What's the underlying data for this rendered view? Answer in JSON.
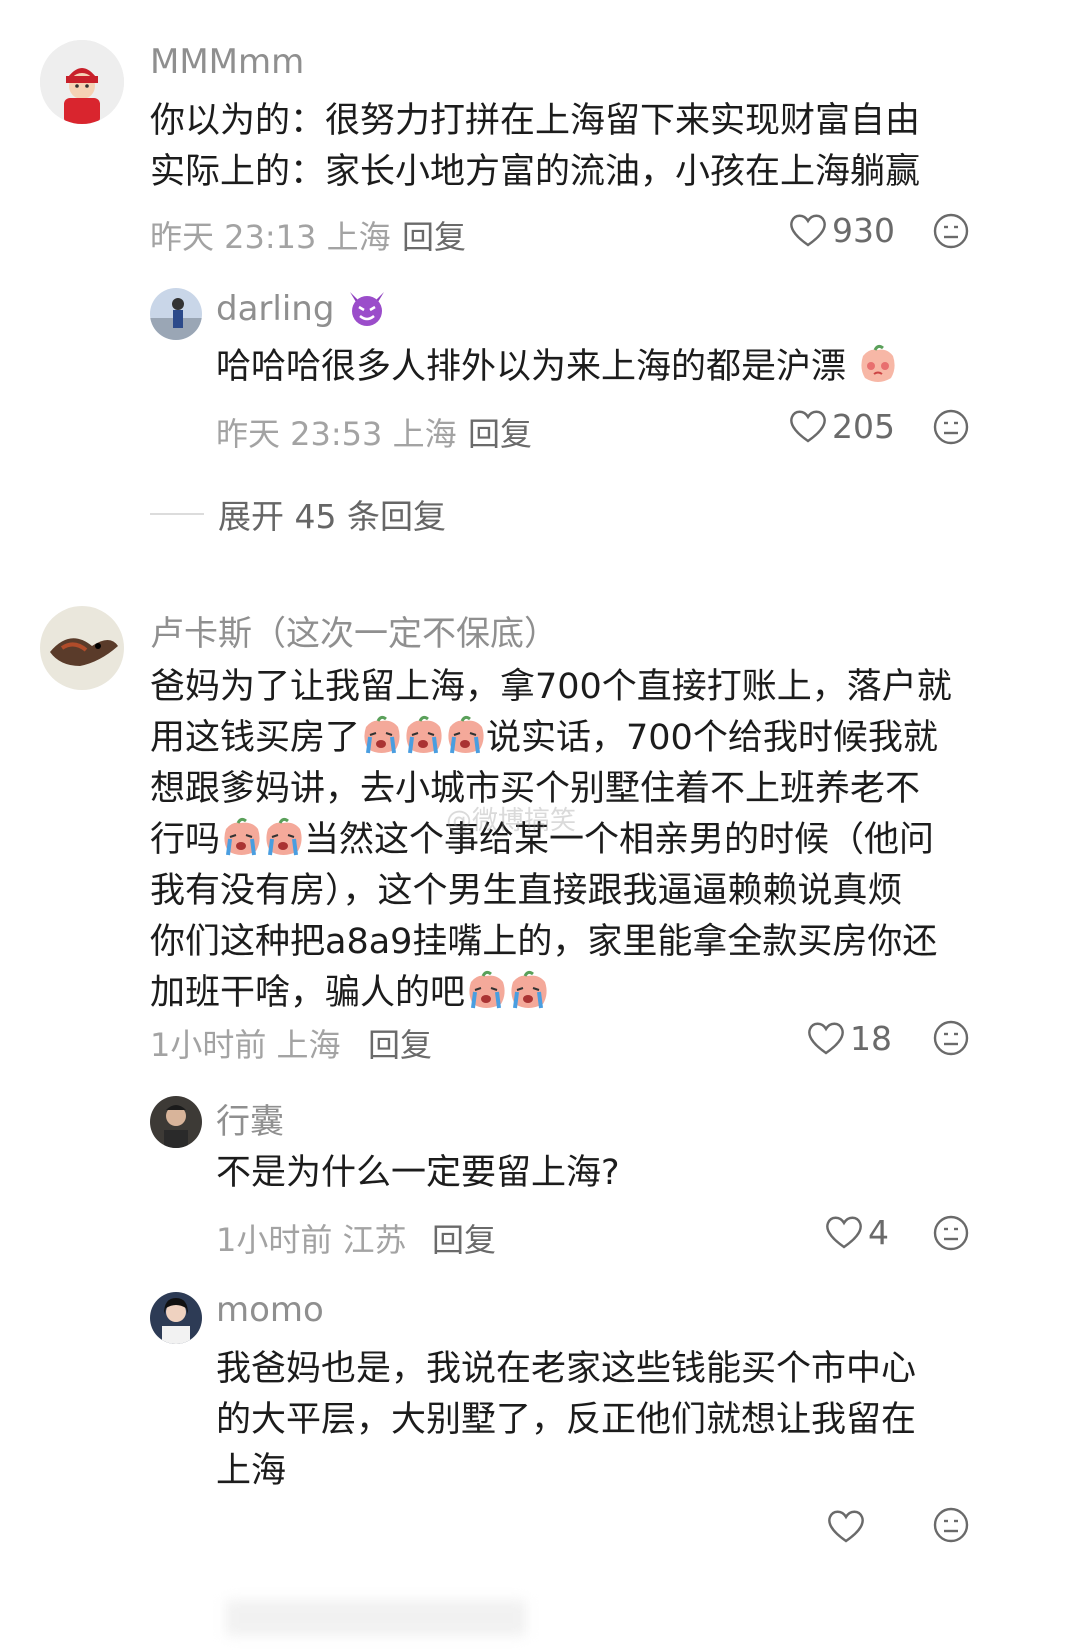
{
  "comments": [
    {
      "user": "MMMmm",
      "text_lines": [
        "你以为的：很努力打拼在上海留下来实现财富自由",
        "实际上的：家长小地方富的流油，小孩在上海躺赢"
      ],
      "time": "昨天 23:13 上海",
      "reply_label": "回复",
      "likes": "930"
    },
    {
      "user": "darling",
      "text": "哈哈哈很多人排外以为来上海的都是沪漂",
      "time": "昨天 23:53 上海",
      "reply_label": "回复",
      "likes": "205",
      "expand_label": "展开 45 条回复"
    },
    {
      "user": "卢卡斯（这次一定不保底）",
      "lines": [
        "爸妈为了让我留上海，拿700个直接打账上，落户就",
        [
          "用这钱买房了",
          "说实话，700个给我时候我就"
        ],
        "想跟爹妈讲，去小城市买个别墅住着不上班养老不",
        [
          "行吗",
          "当然这个事给某一个相亲男的时候（他问"
        ],
        "我有没有房），这个男生直接跟我逼逼赖赖说真烦",
        "你们这种把a8a9挂嘴上的，家里能拿全款买房你还",
        "加班干啥，骗人的吧"
      ],
      "time": "1小时前 上海",
      "reply_label": "回复",
      "likes": "18"
    },
    {
      "user": "行囊",
      "text": "不是为什么一定要留上海?",
      "time": "1小时前 江苏",
      "reply_label": "回复",
      "likes": "4"
    },
    {
      "user": "momo",
      "text_lines": [
        "我爸妈也是，我说在老家这些钱能买个市中心",
        "的大平层，大别墅了，反正他们就想让我留在",
        "上海"
      ]
    }
  ],
  "watermark": "@微博搞笑",
  "colors": {
    "body_text": "#1c1c1c",
    "meta_text": "#a3a3a3",
    "username": "#8f8f8f"
  },
  "icons": [
    "heart-outline-icon",
    "dislike-face-icon",
    "devil-emoji-icon",
    "blush-peach-emoji-icon",
    "crying-peach-emoji-icon"
  ]
}
